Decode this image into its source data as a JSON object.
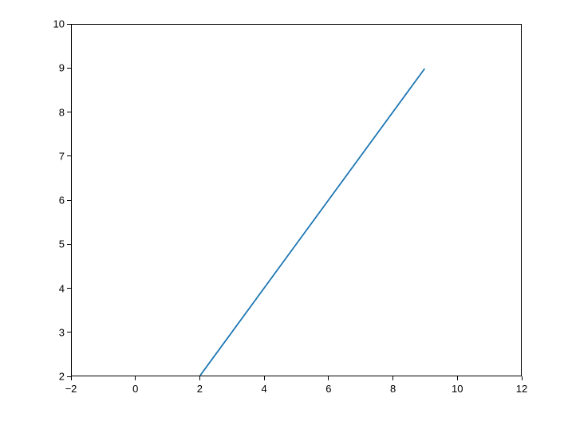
{
  "chart_data": {
    "type": "line",
    "x": [
      2,
      9
    ],
    "y": [
      2,
      9
    ],
    "title": "",
    "xlabel": "",
    "ylabel": "",
    "xlim": [
      -2,
      12
    ],
    "ylim": [
      2,
      10
    ],
    "xticks": [
      -2,
      0,
      2,
      4,
      6,
      8,
      10,
      12
    ],
    "yticks": [
      2,
      3,
      4,
      5,
      6,
      7,
      8,
      9,
      10
    ],
    "line_color": "#1f77b4"
  }
}
